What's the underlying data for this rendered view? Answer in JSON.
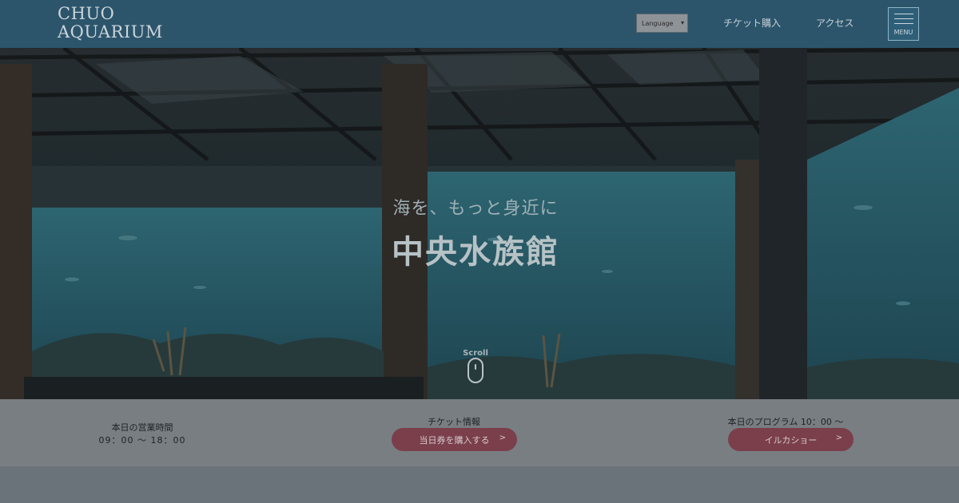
{
  "header": {
    "logo": [
      "CHUO",
      "AQUARIUM"
    ],
    "language_select": "Language",
    "nav": {
      "tickets": "チケット購入",
      "access": "アクセス"
    },
    "menu_label": "MENU"
  },
  "hero": {
    "tagline": "海を、もっと身近に",
    "title": "中央水族館",
    "scroll_label": "Scroll"
  },
  "info": {
    "hours_label": "本日の営業時間",
    "hours_value": "09：00 〜 18：00",
    "ticket_label": "チケット情報",
    "ticket_button": "当日券を購入する",
    "program_label": "本日のプログラム 10：00 〜",
    "program_button": "イルカショー",
    "arrow": ">"
  },
  "colors": {
    "header_bg": "#2c556c",
    "pill_bg": "#7a3f4b",
    "water": "#2a5d69"
  }
}
